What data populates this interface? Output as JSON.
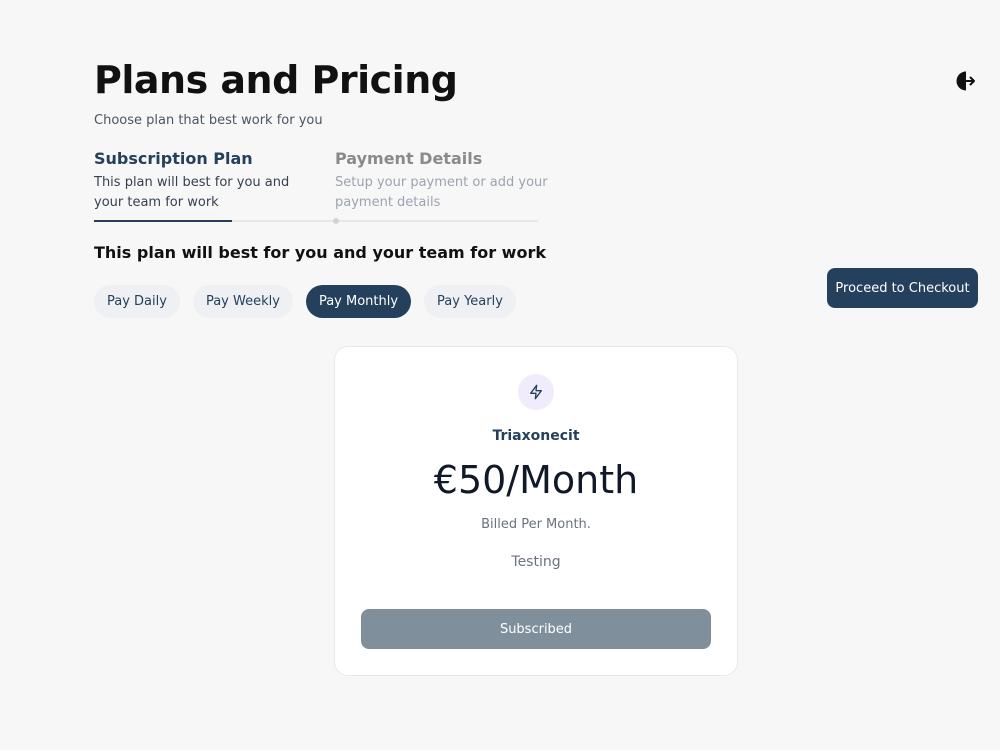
{
  "header": {
    "title": "Plans and Pricing",
    "subtitle": "Choose plan that best work for you"
  },
  "icons": {
    "logout": "logout-icon",
    "plan": "lightning-bolt-icon"
  },
  "stepper": {
    "steps": [
      {
        "title": "Subscription Plan",
        "description": "This plan will best for you and your team for work",
        "state": "active"
      },
      {
        "title": "Payment Details",
        "description": "Setup your payment or add your payment details",
        "state": "inactive"
      }
    ],
    "progress": 0.31
  },
  "section": {
    "heading": "This plan will best for you and your team for work"
  },
  "frequency": {
    "options": [
      "Pay Daily",
      "Pay Weekly",
      "Pay Monthly",
      "Pay Yearly"
    ],
    "selected": "Pay Monthly"
  },
  "checkout": {
    "label": "Proceed to Checkout"
  },
  "plan": {
    "name": "Triaxonecit",
    "price": "€50/Month",
    "billing": "Billed Per Month.",
    "description": "Testing",
    "button_label": "Subscribed"
  },
  "colors": {
    "primary": "#24405d",
    "background": "#f7f7f7",
    "disabled_button": "#7f8f9c",
    "icon_bg": "#f1ecfb"
  }
}
